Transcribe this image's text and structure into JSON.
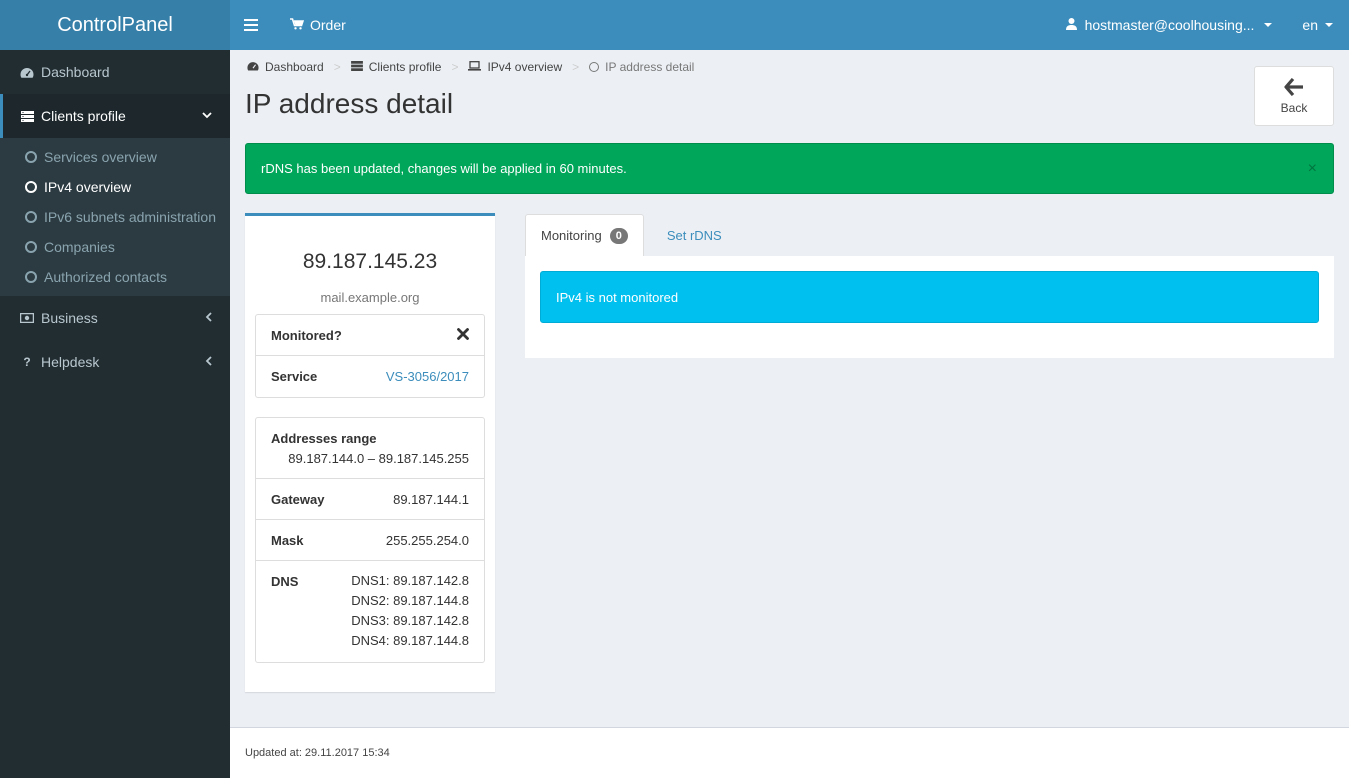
{
  "header": {
    "logo": "ControlPanel",
    "order_label": "Order",
    "user": "hostmaster@coolhousing...",
    "lang": "en"
  },
  "sidebar": {
    "dashboard": "Dashboard",
    "clients_profile": "Clients profile",
    "sub_items": [
      "Services overview",
      "IPv4 overview",
      "IPv6 subnets administration",
      "Companies",
      "Authorized contacts"
    ],
    "business": "Business",
    "helpdesk": "Helpdesk"
  },
  "breadcrumb": [
    "Dashboard",
    "Clients profile",
    "IPv4 overview",
    "IP address detail"
  ],
  "page_title": "IP address detail",
  "back_label": "Back",
  "alert": {
    "message": "rDNS has been updated, changes will be applied in 60 minutes.",
    "close": "×"
  },
  "ip": {
    "address": "89.187.145.23",
    "hostname": "mail.example.org",
    "monitored_label": "Monitored?",
    "service_label": "Service",
    "service_value": "VS-3056/2017",
    "range_label": "Addresses range",
    "range_value": "89.187.144.0 – 89.187.145.255",
    "gateway_label": "Gateway",
    "gateway_value": "89.187.144.1",
    "mask_label": "Mask",
    "mask_value": "255.255.254.0",
    "dns_label": "DNS",
    "dns": [
      "DNS1: 89.187.142.8",
      "DNS2: 89.187.144.8",
      "DNS3: 89.187.142.8",
      "DNS4: 89.187.144.8"
    ]
  },
  "tabs": {
    "monitoring_label": "Monitoring",
    "monitoring_count": "0",
    "rdns_label": "Set rDNS",
    "info_message": "IPv4 is not monitored"
  },
  "footer": {
    "updated": "Updated at: 29.11.2017 15:34"
  },
  "colors": {
    "primary": "#3c8dbc",
    "success": "#00a65a",
    "info": "#00c0ef",
    "sidebar": "#222d32"
  }
}
